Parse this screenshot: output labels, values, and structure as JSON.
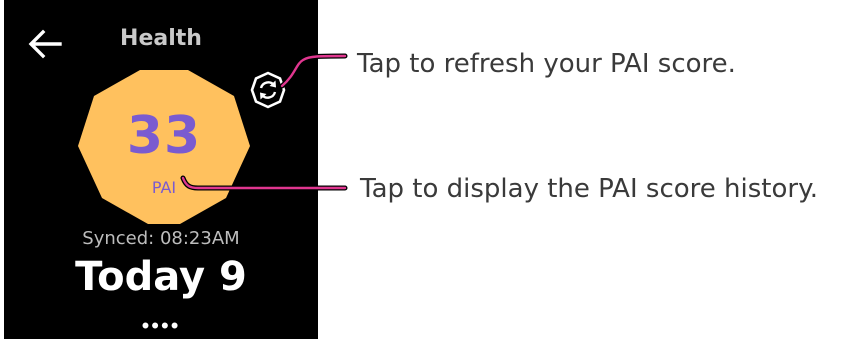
{
  "screen": {
    "title": "Health",
    "back_icon": "arrow-left-icon",
    "refresh_icon": "refresh-icon",
    "pai": {
      "value": "33",
      "label": "PAI"
    },
    "synced_text": "Synced: 08:23AM",
    "today_text": "Today 9",
    "more_indicator": "••••"
  },
  "callouts": {
    "refresh": "Tap to refresh your PAI score.",
    "history": "Tap to display the PAI score history."
  },
  "colors": {
    "watch_background": "#000000",
    "badge_fill": "#ffc15e",
    "score_text": "#7a5bd0",
    "callout_line": "#e0368f"
  }
}
